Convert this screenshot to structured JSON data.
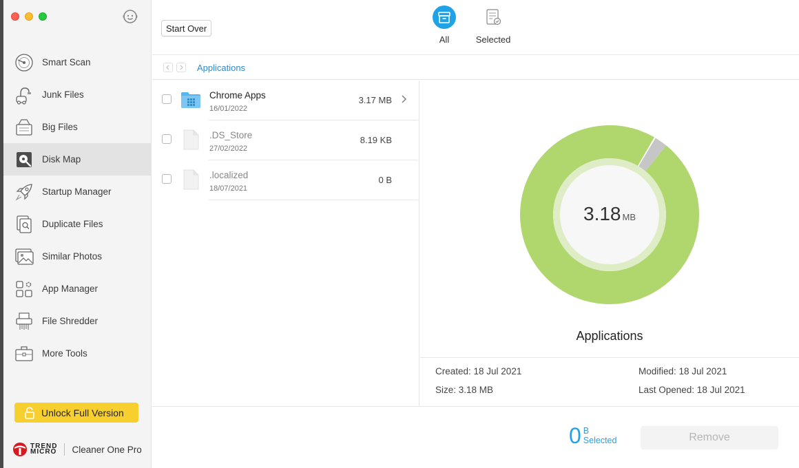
{
  "app": {
    "product_name": "Cleaner One Pro",
    "vendor_logo_text": "TREND MICRO"
  },
  "sidebar": {
    "items": [
      {
        "label": "Smart Scan",
        "icon": "smart-scan-icon"
      },
      {
        "label": "Junk Files",
        "icon": "vacuum-icon"
      },
      {
        "label": "Big Files",
        "icon": "big-files-icon"
      },
      {
        "label": "Disk Map",
        "icon": "disk-map-icon",
        "active": true
      },
      {
        "label": "Startup Manager",
        "icon": "rocket-icon"
      },
      {
        "label": "Duplicate Files",
        "icon": "duplicate-files-icon"
      },
      {
        "label": "Similar Photos",
        "icon": "photo-icon"
      },
      {
        "label": "App Manager",
        "icon": "app-grid-icon"
      },
      {
        "label": "File Shredder",
        "icon": "shredder-icon"
      },
      {
        "label": "More Tools",
        "icon": "toolbox-icon"
      }
    ],
    "unlock_label": "Unlock Full Version"
  },
  "toolbar": {
    "start_over_label": "Start Over",
    "tabs": [
      {
        "label": "All",
        "icon": "archive-box-icon",
        "active": true
      },
      {
        "label": "Selected",
        "icon": "checklist-icon",
        "active": false
      }
    ]
  },
  "breadcrumb": {
    "path": "Applications"
  },
  "files": [
    {
      "name": "Chrome Apps",
      "date": "16/01/2022",
      "size": "3.17 MB",
      "type": "folder",
      "has_children": true
    },
    {
      "name": ".DS_Store",
      "date": "27/02/2022",
      "size": "8.19 KB",
      "type": "file",
      "has_children": false
    },
    {
      "name": ".localized",
      "date": "18/07/2021",
      "size": "0 B",
      "type": "file",
      "has_children": false
    }
  ],
  "detail": {
    "total_value": "3.18",
    "total_unit": "MB",
    "title": "Applications",
    "created": "Created: 18 Jul 2021",
    "size": "Size: 3.18 MB",
    "modified": "Modified: 18 Jul 2021",
    "last_opened": "Last Opened: 18 Jul 2021"
  },
  "donut_segments": [
    {
      "name": "Chrome Apps",
      "fraction": 0.974,
      "color": "#b0d66e"
    },
    {
      "name": ".DS_Store",
      "fraction": 0.0025,
      "color": "#ffffff"
    },
    {
      "name": "other",
      "fraction": 0.0235,
      "color": "#c6c6c6"
    }
  ],
  "colors": {
    "accent": "#20a3e6",
    "unlock": "#f7cf2f",
    "donut_main": "#b0d66e",
    "donut_inner_ring": "#deedc6"
  },
  "footer": {
    "selected_value": "0",
    "selected_unit": "B",
    "selected_label": "Selected",
    "remove_label": "Remove"
  }
}
